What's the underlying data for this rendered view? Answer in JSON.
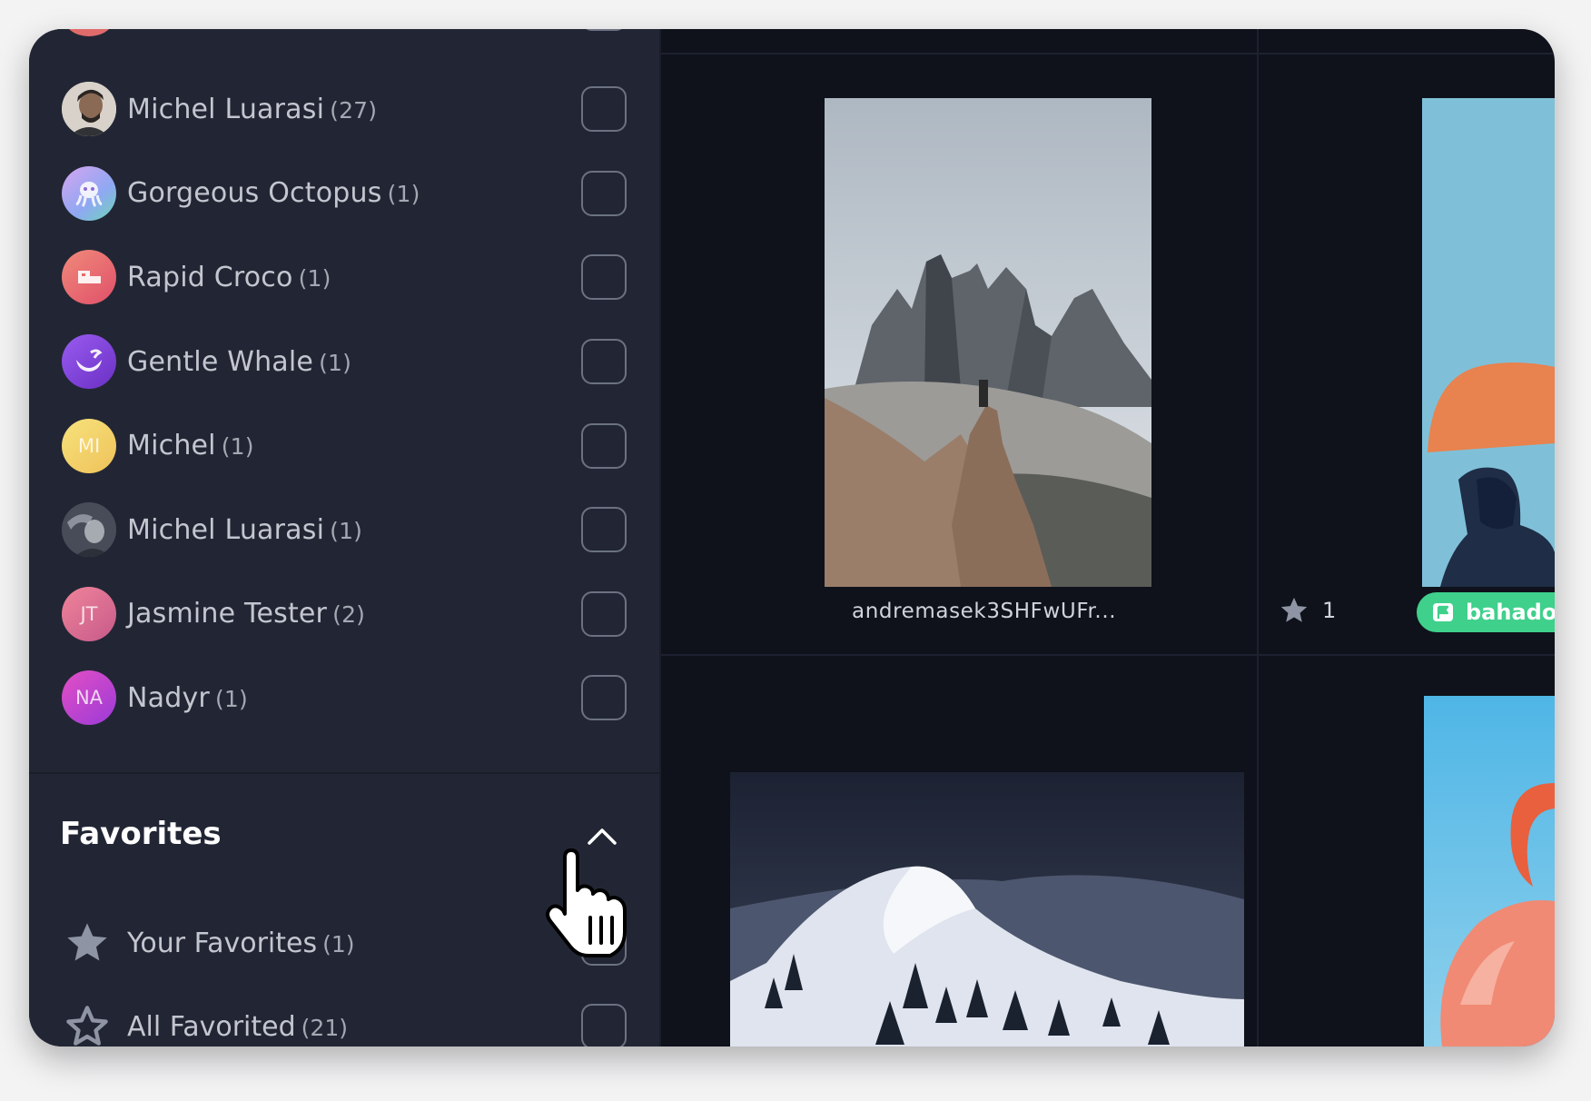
{
  "sidebar": {
    "users": [
      {
        "name": "Michel Luarasi",
        "count": "(27)",
        "avatar_initials": "",
        "avatar_color": "#cfc7bd"
      },
      {
        "name": "Gorgeous Octopus",
        "count": "(1)",
        "avatar_initials": "",
        "avatar_color": "#b98ee6"
      },
      {
        "name": "Rapid Croco",
        "count": "(1)",
        "avatar_initials": "",
        "avatar_color": "#e8696a"
      },
      {
        "name": "Gentle Whale",
        "count": "(1)",
        "avatar_initials": "",
        "avatar_color": "#7a3fd8"
      },
      {
        "name": "Michel",
        "count": "(1)",
        "avatar_initials": "MI",
        "avatar_color": "#f2d36a"
      },
      {
        "name": "Michel Luarasi",
        "count": "(1)",
        "avatar_initials": "",
        "avatar_color": "#4c5260"
      },
      {
        "name": "Jasmine Tester",
        "count": "(2)",
        "avatar_initials": "JT",
        "avatar_color": "#e86c92"
      },
      {
        "name": "Nadyr",
        "count": "(1)",
        "avatar_initials": "NA",
        "avatar_color": "#c94ac2"
      }
    ],
    "favorites": {
      "title": "Favorites",
      "items": [
        {
          "label": "Your Favorites",
          "count": "(1)",
          "icon": "star-filled-icon"
        },
        {
          "label": "All Favorited",
          "count": "(21)",
          "icon": "star-outline-icon"
        }
      ]
    }
  },
  "grid": {
    "photo1_caption": "andremasek3SHFwUFr...",
    "photo2_star_count": "1",
    "photo2_tag": "bahador"
  },
  "colors": {
    "sidebar_bg": "#222634",
    "grid_bg": "#0f121b",
    "tag_green": "#3fd08c"
  }
}
